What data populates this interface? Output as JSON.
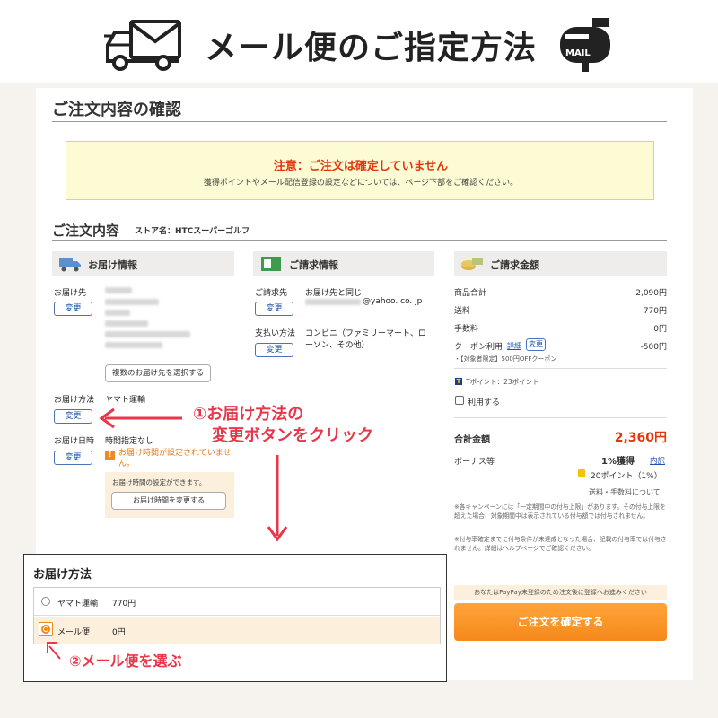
{
  "banner": {
    "title": "メール便のご指定方法",
    "mailbox_label": "MAIL"
  },
  "page_title": "ご注文内容の確認",
  "notice": {
    "title": "注意：ご注文は確定していません",
    "subtitle": "獲得ポイントやメール配信登録の設定などについては、ページ下部をご確認ください。"
  },
  "order": {
    "title": "ご注文内容",
    "store": "ストア名：HTCスーパーゴルフ"
  },
  "delivery": {
    "header": "お届け情報",
    "recipient_label": "お届け先",
    "change_label": "変更",
    "select_multiple_label": "複数のお届け先を選択する",
    "method_label": "お届け方法",
    "method_value": "ヤマト運輸",
    "datetime_label": "お届け日時",
    "datetime_value": "時間指定なし",
    "warning_text": "お届け時間が設定されていません。",
    "time_note": "お届け時間の設定ができます。",
    "time_change_button": "お届け時間を変更する"
  },
  "billing": {
    "header": "ご請求情報",
    "billto_label": "ご請求先",
    "billto_value": "お届け先と同じ",
    "email_value": "@yahoo. co. jp",
    "payment_label": "支払い方法",
    "payment_value_1": "コンビニ（ファミリーマート、ロ",
    "payment_value_2": "ーソン、その他）"
  },
  "amount": {
    "header": "ご請求金額",
    "subtotal_label": "商品合計",
    "subtotal_value": "2,090円",
    "shipping_label": "送料",
    "shipping_value": "770円",
    "fee_label": "手数料",
    "fee_value": "0円",
    "coupon_label": "クーポン利用",
    "coupon_detail": "詳細",
    "coupon_value": "-500円",
    "coupon_note": "・【対象者限定】500円OFFクーポン",
    "tpoint_text": "Tポイント：23ポイント",
    "use_label": "利用する",
    "total_label": "合計金額",
    "total_value": "2,360円",
    "bonus_label": "ボーナス等",
    "bonus_rate": "1%獲得",
    "bonus_detail": "内訳",
    "bonus_points": "20ポイント（1%）",
    "bonus_fee_note": "送料・手数料について",
    "campaign_note_1": "※各キャンペーンには「一定期間中の付与上限」があります。その付与上限を超えた場合、対象期間中は表示されている付与額では付与されません。",
    "campaign_note_2": "※付与率確定までに付与条件が未達成となった場合、記載の付与率では付与されません。詳細はヘルプページでご確認ください。",
    "paypay_note": "あなたはPayPay未登録のため注文後に登録へお進みください",
    "confirm_button": "ご注文を確定する"
  },
  "annotations": {
    "step1_line1": "①お届け方法の",
    "step1_line2": "変更ボタンをクリック",
    "step2": "②メール便を選ぶ"
  },
  "popup": {
    "title": "お届け方法",
    "options": [
      {
        "name": "ヤマト運輸",
        "price": "770円",
        "selected": false
      },
      {
        "name": "メール便",
        "price": "0円",
        "selected": true
      }
    ]
  },
  "colors": {
    "accent_red": "#e8364a",
    "notice_red": "#e3360f",
    "link_blue": "#1f55a8",
    "button_orange": "#f5891b"
  }
}
